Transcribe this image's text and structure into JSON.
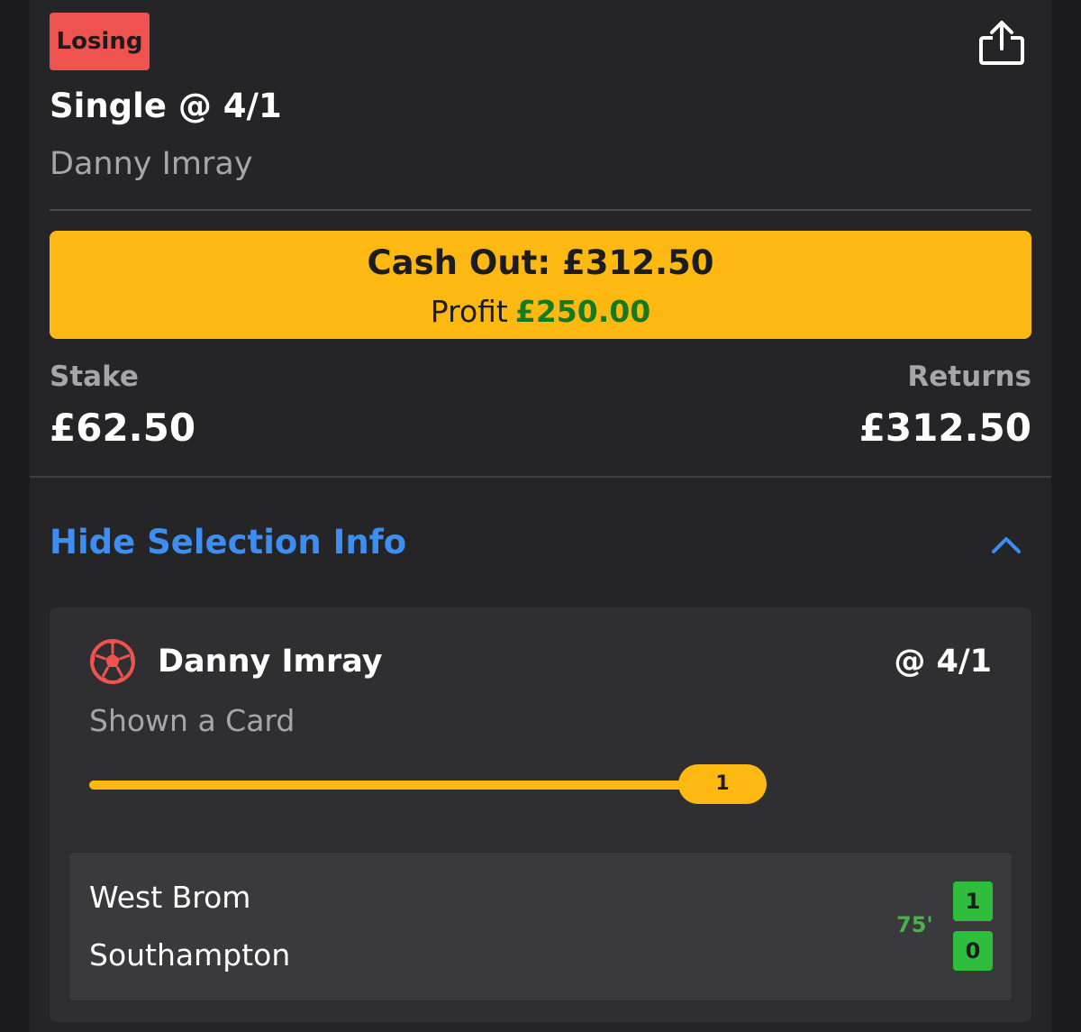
{
  "bet": {
    "status": "Losing",
    "title": "Single @ 4/1",
    "subtitle": "Danny Imray"
  },
  "cash_out": {
    "label": "Cash Out: £312.50",
    "profit_label": "Profit",
    "profit_value": "£250.00"
  },
  "stake": {
    "label": "Stake",
    "value": "£62.50"
  },
  "returns": {
    "label": "Returns",
    "value": "£312.50"
  },
  "selection_toggle": {
    "label": "Hide Selection Info",
    "state": "expanded"
  },
  "selection": {
    "sport_icon": "football-icon",
    "player": "Danny Imray",
    "odds": "@ 4/1",
    "market": "Shown a Card",
    "progress": {
      "current_label": "1",
      "fill_fraction": 1.0
    }
  },
  "match": {
    "home_team": "West Brom",
    "away_team": "Southampton",
    "clock": "75'",
    "home_score": "1",
    "away_score": "0"
  },
  "colors": {
    "losing_badge": "#ef5350",
    "accent_yellow": "#fdb811",
    "profit_green": "#157a1c",
    "link_blue": "#3d8ef0",
    "score_green": "#2ebd3c",
    "clock_green": "#4caf50"
  },
  "icons": {
    "share": "share-icon",
    "collapse": "chevron-up-icon",
    "sport": "football-icon"
  }
}
